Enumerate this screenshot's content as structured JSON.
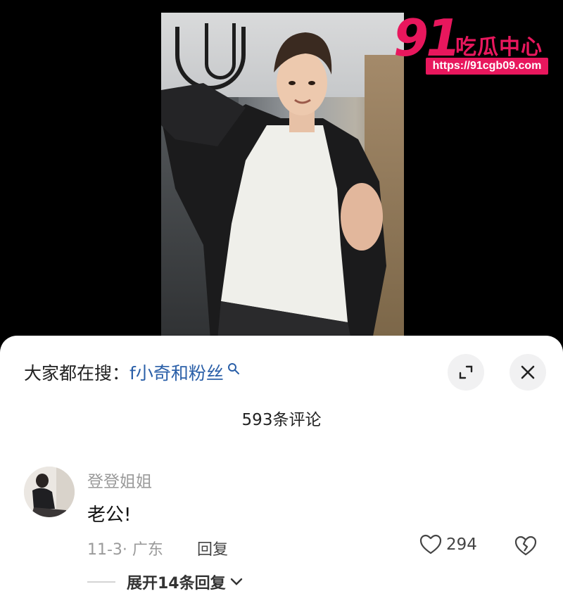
{
  "watermark": {
    "brand_number": "91",
    "brand_text": "吃瓜中心",
    "url": "https://91cgb09.com"
  },
  "sheet": {
    "search_prefix": "大家都在搜：",
    "search_term": "f小奇和粉丝",
    "comment_count": "593条评论"
  },
  "comment": {
    "username": "登登姐姐",
    "text": "老公!",
    "meta": "11-3· 广东",
    "reply_label": "回复",
    "like_count": "294",
    "expand_label": "展开14条回复"
  },
  "icons": {
    "search": "search-icon",
    "expand": "expand-icon",
    "close": "close-icon",
    "like": "heart-icon",
    "dislike": "broken-heart-icon",
    "chevron": "chevron-down-icon"
  },
  "colors": {
    "brand": "#e8175d",
    "search_term": "#2a5fa8",
    "muted": "#9a9a9a"
  }
}
